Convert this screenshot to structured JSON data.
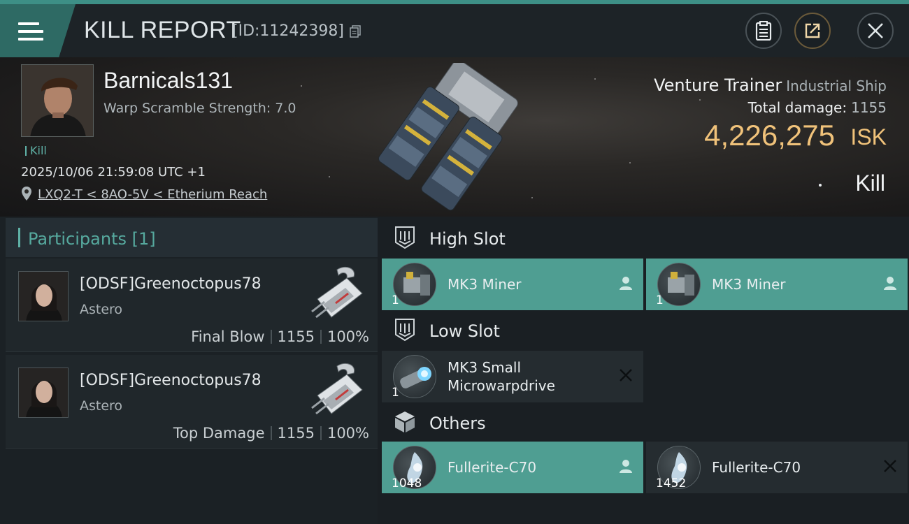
{
  "header": {
    "title": "KILL REPORT",
    "report_id": "[ID:11242398]",
    "menu_icon": "hamburger-menu-icon",
    "buttons": [
      "clipboard-icon",
      "share-icon",
      "close-icon"
    ]
  },
  "victim": {
    "name": "Barnicals131",
    "subtitle": "Warp Scramble Strength: 7.0",
    "tag": "Kill",
    "date": "2025/10/06 21:59:08 UTC +1",
    "location": "LXQ2-T < 8AO-5V < Etherium Reach",
    "ship_name": "Venture Trainer",
    "ship_class": "Industrial Ship",
    "total_damage_label": "Total damage:",
    "total_damage": "1155",
    "isk_value": "4,226,275",
    "isk_unit": "ISK",
    "status": "Kill"
  },
  "participants": {
    "title": "Participants [1]",
    "items": [
      {
        "name": "[ODSF]Greenoctopus78",
        "ship": "Astero",
        "role": "Final Blow",
        "damage": "1155",
        "percent": "100%"
      },
      {
        "name": "[ODSF]Greenoctopus78",
        "ship": "Astero",
        "role": "Top Damage",
        "damage": "1155",
        "percent": "100%"
      }
    ]
  },
  "fitting": {
    "high_slot": {
      "title": "High Slot",
      "items": [
        {
          "name": "MK3 Miner",
          "qty": "1",
          "state": "dropped"
        },
        {
          "name": "MK3 Miner",
          "qty": "1",
          "state": "dropped"
        }
      ]
    },
    "low_slot": {
      "title": "Low Slot",
      "items": [
        {
          "name_line1": "MK3 Small",
          "name_line2": "Microwarpdrive",
          "qty": "1",
          "state": "destroyed"
        }
      ]
    },
    "others": {
      "title": "Others",
      "items": [
        {
          "name": "Fullerite-C70",
          "qty": "1048",
          "state": "dropped"
        },
        {
          "name": "Fullerite-C70",
          "qty": "1452",
          "state": "destroyed"
        }
      ]
    }
  },
  "colors": {
    "accent": "#5fb2a7",
    "dropped": "#4f9e92",
    "destroyed": "#252c30",
    "isk": "#f0c27a"
  }
}
